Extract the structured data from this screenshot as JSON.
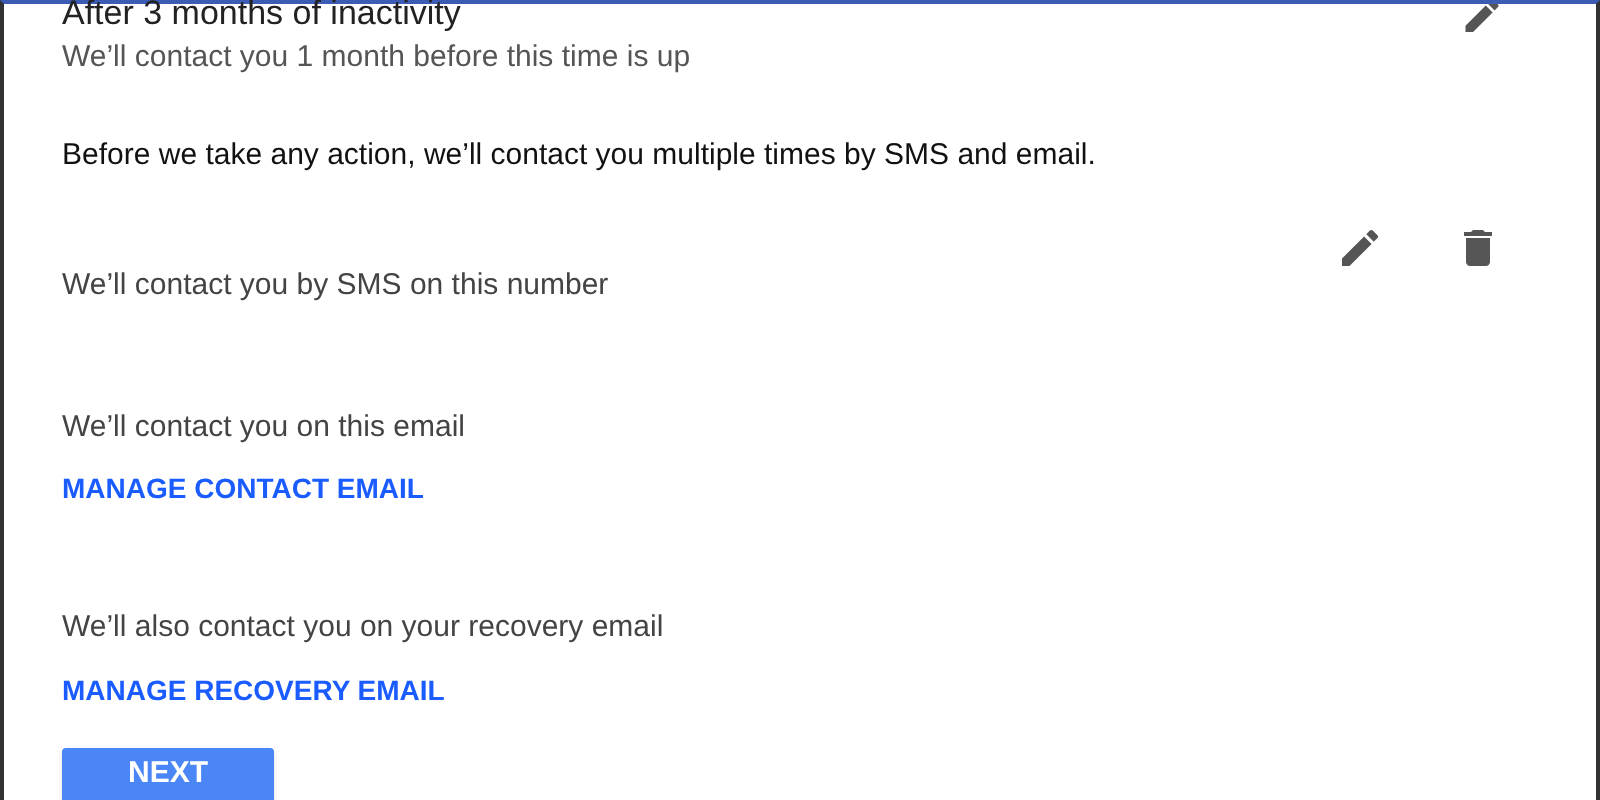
{
  "inactivity": {
    "title": "After 3 months of inactivity",
    "subtitle": "We’ll contact you 1 month before this time is up"
  },
  "notice": "Before we take any action, we’ll contact you multiple times by SMS and email.",
  "sms": {
    "label": "We’ll contact you by SMS on this number"
  },
  "contact_email": {
    "label": "We’ll contact you on this email",
    "link": "MANAGE CONTACT EMAIL"
  },
  "recovery_email": {
    "label": "We’ll also contact you on your recovery email",
    "link": "MANAGE RECOVERY EMAIL"
  },
  "next_button": "NEXT"
}
